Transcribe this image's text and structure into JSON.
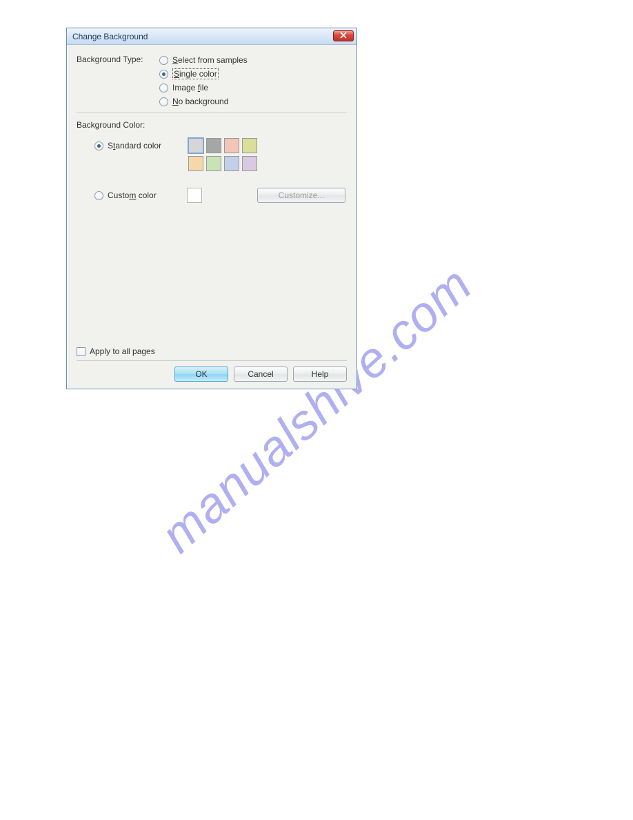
{
  "watermark": "manualshive.com",
  "dialog": {
    "title": "Change Background",
    "bg_type_label": "Background Type:",
    "bg_type_options": {
      "select_samples": {
        "prefix": "S",
        "rest": "elect from samples",
        "checked": false
      },
      "single_color": {
        "prefix": "S",
        "rest": "ingle color",
        "checked": true,
        "focused": true
      },
      "image_file": {
        "prefix_text": "Image ",
        "u": "f",
        "suffix": "ile",
        "checked": false
      },
      "no_background": {
        "prefix": "N",
        "rest": "o background",
        "checked": false
      }
    },
    "bg_color_label": "Background Color:",
    "color_mode": {
      "standard": {
        "prefix": "S",
        "u": "t",
        "rest": "andard color",
        "checked": true
      },
      "custom": {
        "prefix": "Custo",
        "u": "m",
        "rest": " color",
        "checked": false
      }
    },
    "standard_colors": [
      {
        "hex": "#d6d6d6",
        "selected": true
      },
      {
        "hex": "#a6a6a6",
        "selected": false
      },
      {
        "hex": "#f3c4b8",
        "selected": false
      },
      {
        "hex": "#d9de9b",
        "selected": false
      },
      {
        "hex": "#f6d8a8",
        "selected": false
      },
      {
        "hex": "#c7e4b6",
        "selected": false
      },
      {
        "hex": "#c4cfe9",
        "selected": false
      },
      {
        "hex": "#d9c9e2",
        "selected": false
      }
    ],
    "custom_color": "#ffffff",
    "customize_btn": {
      "u": "C",
      "rest": "ustomize...",
      "disabled": true
    },
    "apply_all_label": "Apply to all pages",
    "apply_all_checked": false,
    "buttons": {
      "ok": "OK",
      "cancel": "Cancel",
      "help": "Help"
    }
  }
}
